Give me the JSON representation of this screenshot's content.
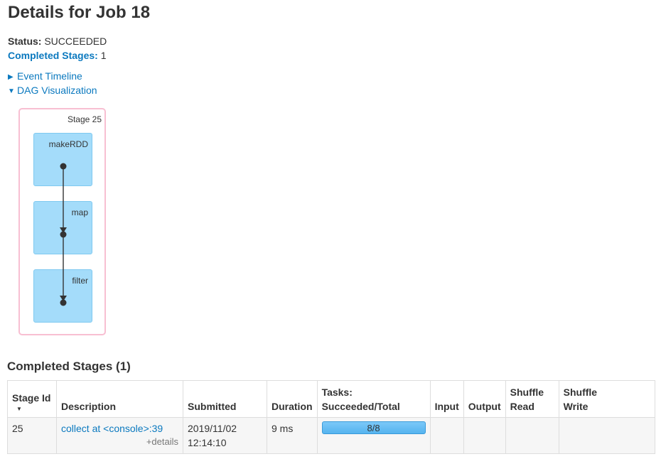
{
  "page": {
    "title": "Details for Job 18"
  },
  "summary": {
    "status_label": "Status:",
    "status_value": "SUCCEEDED",
    "completed_label": "Completed Stages:",
    "completed_value": "1"
  },
  "toggles": {
    "event_timeline": "Event Timeline",
    "dag_visualization": "DAG Visualization"
  },
  "dag": {
    "stage_label": "Stage 25",
    "rdds": [
      "makeRDD",
      "map",
      "filter"
    ],
    "colors": {
      "stage_border": "#f8bfd2",
      "rdd_fill": "#a4dcfa",
      "node": "#333333"
    }
  },
  "completed_stages": {
    "title": "Completed Stages (1)",
    "headers": {
      "stage_id": "Stage Id",
      "description": "Description",
      "submitted": "Submitted",
      "duration": "Duration",
      "tasks_line1": "Tasks:",
      "tasks_line2": "Succeeded/Total",
      "input": "Input",
      "output": "Output",
      "shuffle_read_1": "Shuffle",
      "shuffle_read_2": "Read",
      "shuffle_write_1": "Shuffle",
      "shuffle_write_2": "Write"
    },
    "rows": [
      {
        "stage_id": "25",
        "description": "collect at <console>:39",
        "details": "+details",
        "submitted_date": "2019/11/02",
        "submitted_time": "12:14:10",
        "duration": "9 ms",
        "tasks": "8/8",
        "tasks_progress": 1.0,
        "input": "",
        "output": "",
        "shuffle_read": "",
        "shuffle_write": ""
      }
    ]
  },
  "colors": {
    "link": "#0b79bf",
    "progress": "#55b4ef"
  }
}
